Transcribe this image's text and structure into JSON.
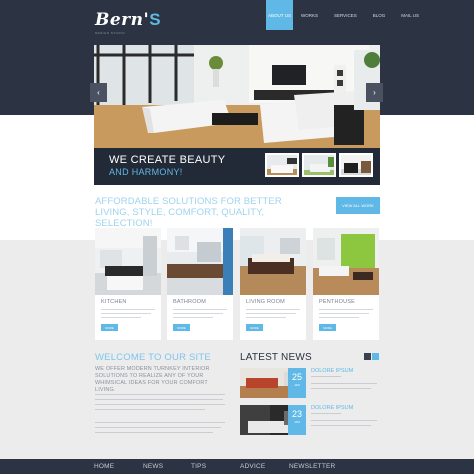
{
  "site": {
    "logo": "Bern'",
    "logo_accent": "S",
    "tagline": "DESIGN STUDIO"
  },
  "nav": {
    "items": [
      "ABOUT US",
      "WORKS",
      "SERVICES",
      "BLOG",
      "MAIL US"
    ],
    "active_index": 0
  },
  "slider": {
    "heading": "WE CREATE BEAUTY",
    "subheading": "AND HARMONY!",
    "prev_icon": "chevron-left-icon",
    "next_icon": "chevron-right-icon"
  },
  "promo": {
    "tagline": "AFFORDABLE SOLUTIONS FOR BETTER LIVING, STYLE, COMFORT, QUALITY, SELECTION!",
    "button": "VIEW ALL WORK"
  },
  "cards": [
    {
      "title": "KITCHEN",
      "button": "MORE"
    },
    {
      "title": "BATHROOM",
      "button": "MORE"
    },
    {
      "title": "LIVING ROOM",
      "button": "MORE"
    },
    {
      "title": "PENTHOUSE",
      "button": "MORE"
    }
  ],
  "welcome": {
    "title": "WELCOME TO OUR SITE",
    "intro": "WE OFFER MODERN TURNKEY INTERIOR SOLUTIONS TO REALIZE ANY OF YOUR WHIMSICAL IDEAS FOR YOUR COMFORT LIVING."
  },
  "news": {
    "title": "LATEST NEWS",
    "items": [
      {
        "day": "25",
        "month": "JAN",
        "heading": "DOLORE IPSUM"
      },
      {
        "day": "23",
        "month": "JAN",
        "heading": "DOLORE IPSUM"
      }
    ]
  },
  "footer": {
    "items": [
      "HOME",
      "NEWS",
      "TIPS",
      "ADVICE",
      "NEWSLETTER"
    ]
  },
  "colors": {
    "accent": "#5fb8e6",
    "dark": "#2c3342"
  }
}
